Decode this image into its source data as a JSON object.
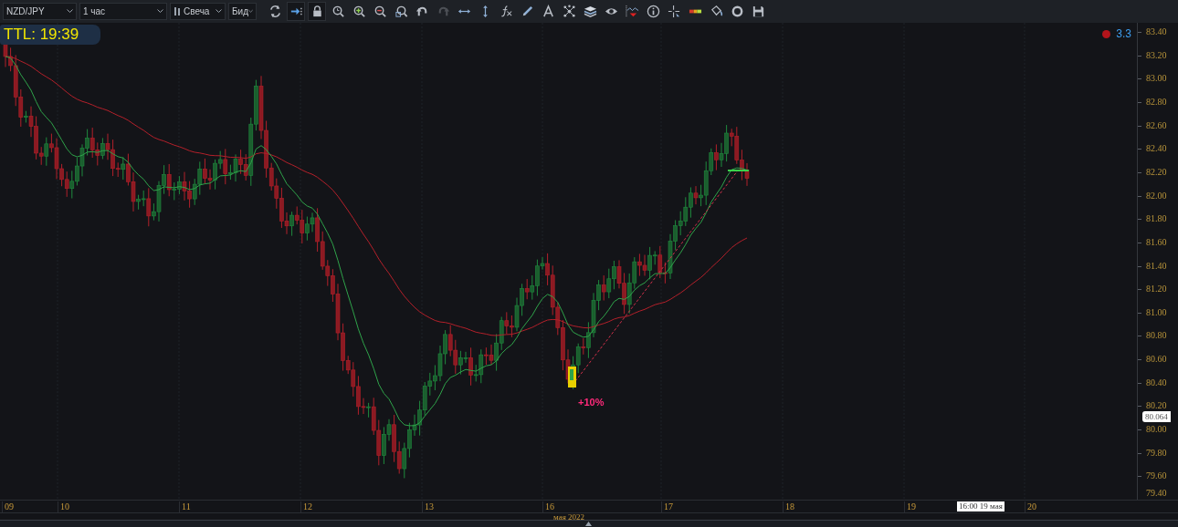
{
  "toolbar": {
    "symbol": "NZD/JPY",
    "timeframe": "1 час",
    "chart_type": "Свеча",
    "price_type": "Бид",
    "tools": [
      {
        "kind": "refresh",
        "active": false,
        "disabled": false
      },
      {
        "kind": "autoscroll",
        "active": true,
        "disabled": false
      },
      {
        "kind": "lock",
        "active": true,
        "disabled": false
      },
      {
        "kind": "zoom-reset",
        "active": false,
        "disabled": false
      },
      {
        "kind": "zoom-in",
        "active": false,
        "disabled": false
      },
      {
        "kind": "zoom-out",
        "active": false,
        "disabled": false
      },
      {
        "kind": "zoom-area",
        "active": false,
        "disabled": false
      },
      {
        "kind": "undo",
        "active": false,
        "disabled": false
      },
      {
        "kind": "redo",
        "active": false,
        "disabled": true
      },
      {
        "kind": "horizontal",
        "active": false,
        "disabled": false
      },
      {
        "kind": "vertical",
        "active": false,
        "disabled": false
      },
      {
        "kind": "fx",
        "active": false,
        "disabled": false
      },
      {
        "kind": "pencil",
        "active": false,
        "disabled": false
      },
      {
        "kind": "text",
        "active": false,
        "disabled": false
      },
      {
        "kind": "nodes",
        "active": false,
        "disabled": false
      },
      {
        "kind": "layers",
        "active": false,
        "disabled": false
      },
      {
        "kind": "eye",
        "active": false,
        "disabled": false
      },
      {
        "kind": "wave",
        "active": false,
        "disabled": false
      },
      {
        "kind": "info",
        "active": false,
        "disabled": false
      },
      {
        "kind": "crosshair",
        "active": false,
        "disabled": false
      },
      {
        "kind": "colors",
        "active": false,
        "disabled": false
      },
      {
        "kind": "bucket",
        "active": false,
        "disabled": false
      },
      {
        "kind": "ring",
        "active": false,
        "disabled": false
      },
      {
        "kind": "save",
        "active": false,
        "disabled": false
      }
    ]
  },
  "ttl": "TTL: 19:39",
  "indicator": {
    "value": "3.3"
  },
  "annotation": {
    "text": "+10%"
  },
  "price_axis": {
    "labels": [
      "83.40",
      "83.20",
      "83.00",
      "82.80",
      "82.60",
      "82.40",
      "82.20",
      "82.00",
      "81.80",
      "81.60",
      "81.40",
      "81.20",
      "81.00",
      "80.80",
      "80.60",
      "80.40",
      "80.20",
      "80.00",
      "79.80",
      "79.60",
      "79.40"
    ],
    "current_price": "80.064"
  },
  "time_axis": {
    "labels": [
      "09",
      "10",
      "11",
      "12",
      "13",
      "16",
      "17",
      "18",
      "19",
      "20"
    ],
    "crosshair_label": "16:00 19 мая",
    "month_label": "мая 2022"
  }
}
